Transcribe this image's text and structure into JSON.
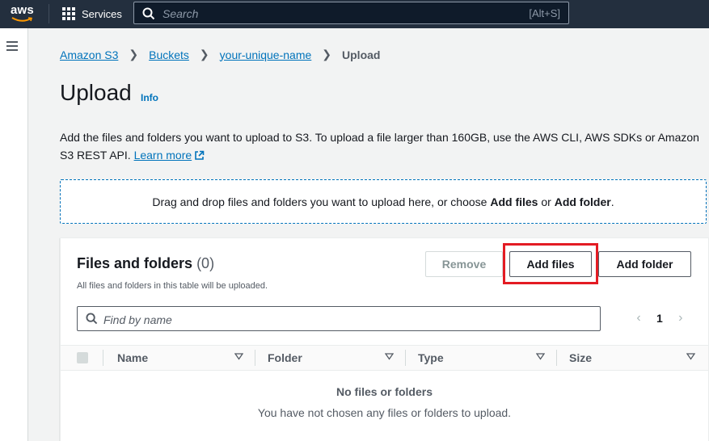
{
  "topnav": {
    "logo_text": "aws",
    "services_label": "Services",
    "search_placeholder": "Search",
    "search_shortcut": "[Alt+S]"
  },
  "breadcrumb": {
    "items": [
      "Amazon S3",
      "Buckets",
      "your-unique-name"
    ],
    "current": "Upload"
  },
  "page": {
    "title": "Upload",
    "info_label": "Info",
    "description": "Add the files and folders you want to upload to S3. To upload a file larger than 160GB, use the AWS CLI, AWS SDKs or Amazon S3 REST API.",
    "learn_more": "Learn more"
  },
  "dropzone": {
    "text_before": "Drag and drop files and folders you want to upload here, or choose ",
    "add_files": "Add files",
    "text_mid": " or ",
    "add_folder": "Add folder",
    "text_end": "."
  },
  "files_panel": {
    "title": "Files and folders",
    "count": "(0)",
    "subtitle": "All files and folders in this table will be uploaded.",
    "remove_label": "Remove",
    "add_files_label": "Add files",
    "add_folder_label": "Add folder",
    "find_placeholder": "Find by name",
    "page_number": "1",
    "columns": [
      "Name",
      "Folder",
      "Type",
      "Size"
    ],
    "empty_title": "No files or folders",
    "empty_subtitle": "You have not chosen any files or folders to upload."
  },
  "colors": {
    "nav_bg": "#232f3e",
    "link": "#0073bb",
    "highlight": "#e31b23",
    "aws_orange": "#ff9900"
  }
}
